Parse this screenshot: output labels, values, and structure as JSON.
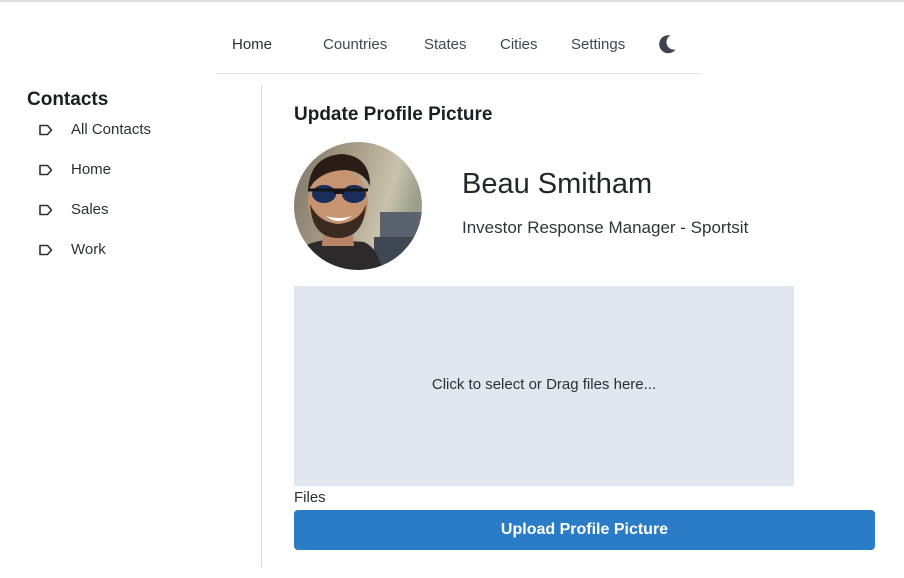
{
  "nav": {
    "items": [
      "Home",
      "Countries",
      "States",
      "Cities",
      "Settings"
    ],
    "theme_icon": "moon-icon"
  },
  "sidebar": {
    "title": "Contacts",
    "items": [
      {
        "label": "All Contacts",
        "icon": "tag-icon"
      },
      {
        "label": "Home",
        "icon": "tag-icon"
      },
      {
        "label": "Sales",
        "icon": "tag-icon"
      },
      {
        "label": "Work",
        "icon": "tag-icon"
      }
    ]
  },
  "main": {
    "title": "Update Profile Picture",
    "profile": {
      "name": "Beau Smitham",
      "role": "Investor Response Manager - Sportsit",
      "avatar_icon": "avatar-photo"
    },
    "dropzone_text": "Click to select or Drag files here...",
    "files_label": "Files",
    "upload_label": "Upload Profile Picture"
  },
  "colors": {
    "accent": "#2a7cc7",
    "dropzone_bg": "#e1e7ef"
  }
}
